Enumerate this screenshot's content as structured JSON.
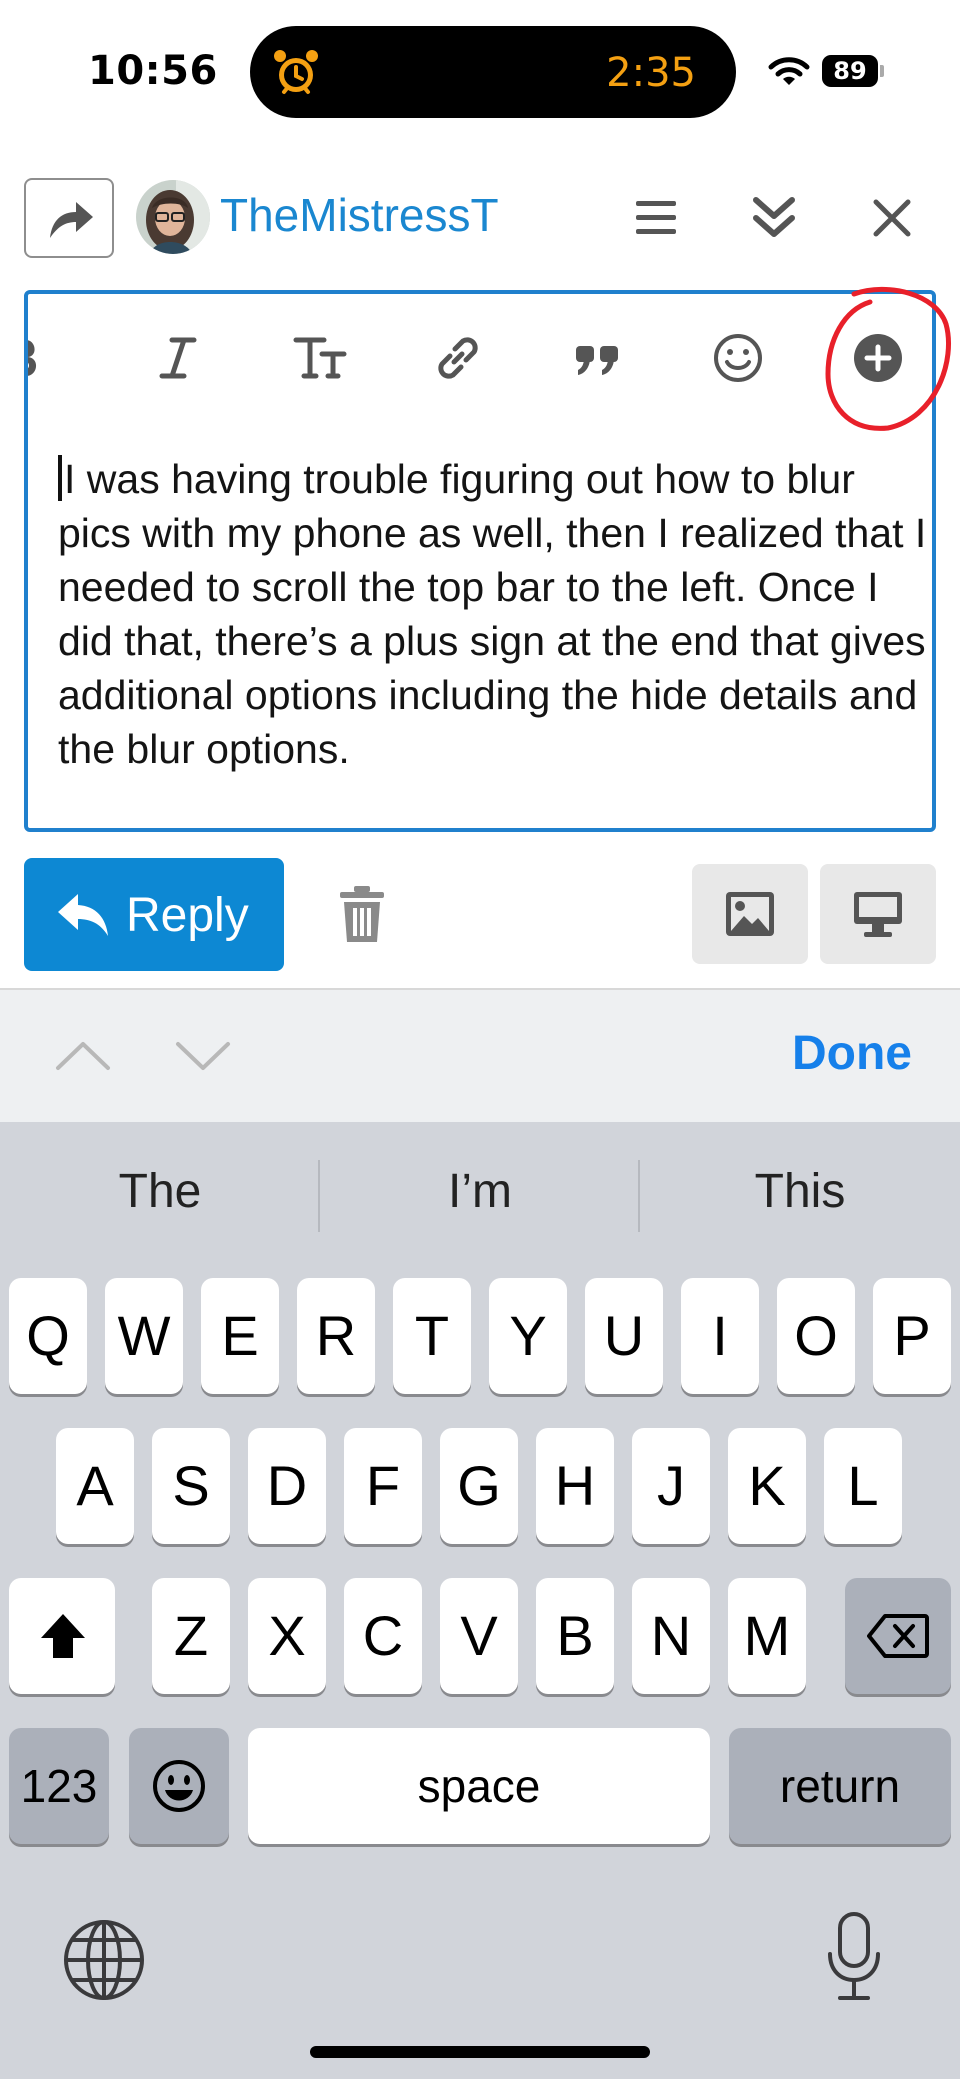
{
  "status_bar": {
    "time": "10:56",
    "timer": "2:35",
    "battery": "89"
  },
  "header": {
    "username": "TheMistressT"
  },
  "editor": {
    "text": "I was having trouble figuring out how to blur pics with my phone as well, then I realized that I needed to scroll the top bar to the left. Once I did that, there’s a plus sign at the end that gives additional options including the hide details and the blur options."
  },
  "actions": {
    "reply_label": "Reply"
  },
  "accessory": {
    "done_label": "Done"
  },
  "keyboard": {
    "suggestions": [
      "The",
      "I’m",
      "This"
    ],
    "row1": [
      "Q",
      "W",
      "E",
      "R",
      "T",
      "Y",
      "U",
      "I",
      "O",
      "P"
    ],
    "row2": [
      "A",
      "S",
      "D",
      "F",
      "G",
      "H",
      "J",
      "K",
      "L"
    ],
    "row3": [
      "Z",
      "X",
      "C",
      "V",
      "B",
      "N",
      "M"
    ],
    "numbers_label": "123",
    "space_label": "space",
    "return_label": "return"
  },
  "colors": {
    "accent": "#0d88d3",
    "link": "#1a87d0",
    "done": "#1680ea",
    "annotation": "#e8202a"
  }
}
